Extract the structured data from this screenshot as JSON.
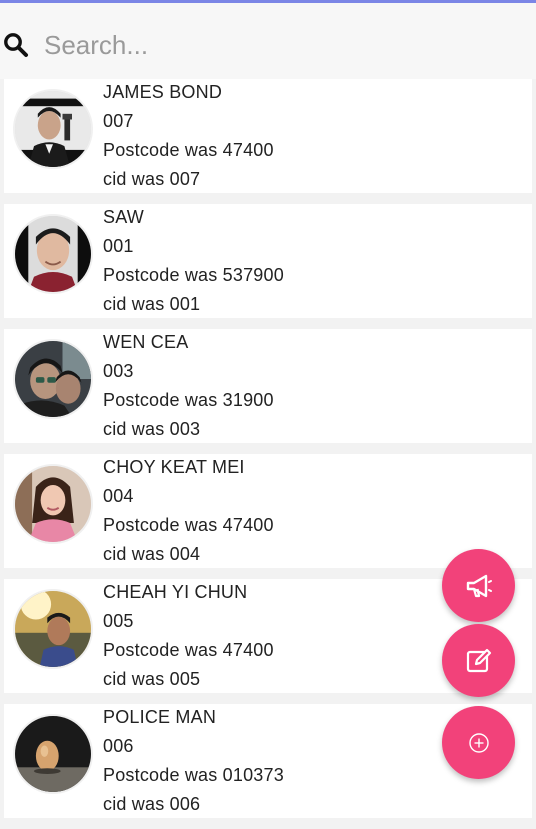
{
  "search": {
    "placeholder": "Search..."
  },
  "contacts": [
    {
      "name": "JAMES BOND",
      "code": "007",
      "postcode": "Postcode was 47400",
      "cid": "cid was 007"
    },
    {
      "name": "SAW",
      "code": "001",
      "postcode": "Postcode was 537900",
      "cid": "cid was 001"
    },
    {
      "name": "WEN CEA",
      "code": "003",
      "postcode": "Postcode was 31900",
      "cid": "cid was 003"
    },
    {
      "name": "CHOY KEAT MEI",
      "code": "004",
      "postcode": "Postcode was 47400",
      "cid": "cid was 004"
    },
    {
      "name": "CHEAH YI CHUN",
      "code": "005",
      "postcode": "Postcode was 47400",
      "cid": "cid was 005"
    },
    {
      "name": "POLICE MAN",
      "code": "006",
      "postcode": "Postcode was 010373",
      "cid": "cid was 006"
    }
  ],
  "fabs": [
    {
      "icon": "megaphone-icon"
    },
    {
      "icon": "edit-icon"
    },
    {
      "icon": "add-circle-icon"
    }
  ],
  "colors": {
    "accent": "#f2427a",
    "top_line": "#7b86e6",
    "background": "#f2f2f2"
  }
}
